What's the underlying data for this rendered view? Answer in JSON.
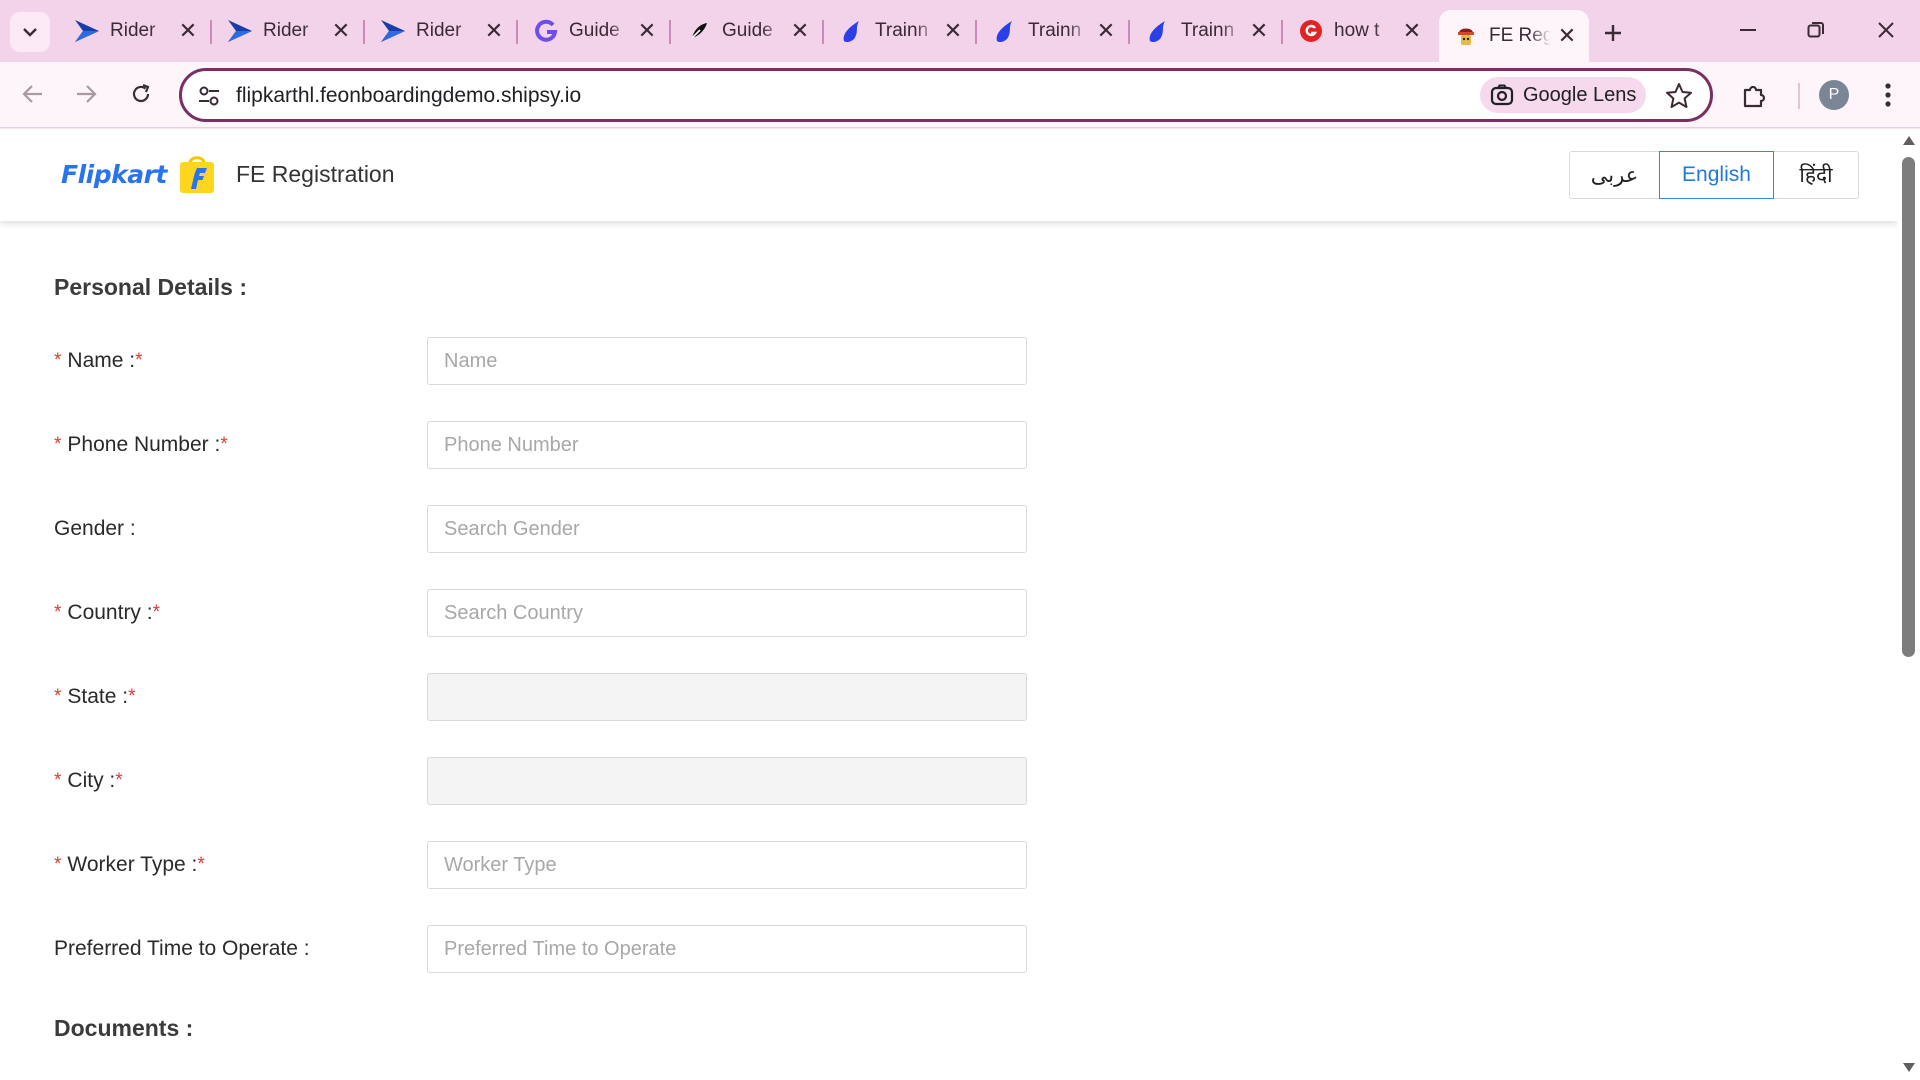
{
  "browser": {
    "tabs": [
      {
        "title": "Rider",
        "icon": "fe-logo-icon"
      },
      {
        "title": "Rider",
        "icon": "fe-logo-icon"
      },
      {
        "title": "Rider",
        "icon": "fe-logo-icon"
      },
      {
        "title": "Guide",
        "icon": "g-logo-icon"
      },
      {
        "title": "Guide",
        "icon": "feather-logo-icon"
      },
      {
        "title": "Trainn",
        "icon": "flame-logo-icon"
      },
      {
        "title": "Trainn",
        "icon": "flame-logo-icon"
      },
      {
        "title": "Trainn",
        "icon": "flame-logo-icon"
      },
      {
        "title": "how t",
        "icon": "red-g-logo-icon"
      },
      {
        "title": "FE Reg",
        "icon": "hat-logo-icon",
        "active": true
      }
    ],
    "url": "flipkarthl.feonboardingdemo.shipsy.io",
    "lens_label": "Google Lens",
    "profile_initial": "P",
    "accent_color": "#7a2f62"
  },
  "header": {
    "brand": "Flipkart",
    "title": "FE Registration",
    "languages": [
      "عربى",
      "English",
      "हिंदी"
    ],
    "selected_language": "English"
  },
  "form": {
    "personal_title": "Personal Details :",
    "fields": {
      "name": {
        "label": "Name :",
        "placeholder": "Name"
      },
      "phone": {
        "label": "Phone Number :",
        "placeholder": "Phone Number"
      },
      "gender": {
        "label": "Gender :",
        "placeholder": "Search Gender"
      },
      "country": {
        "label": "Country :",
        "placeholder": "Search Country"
      },
      "state": {
        "label": "State :",
        "placeholder": ""
      },
      "city": {
        "label": "City :",
        "placeholder": ""
      },
      "worker_type": {
        "label": "Worker Type :",
        "placeholder": "Worker Type"
      },
      "preferred_time": {
        "label": "Preferred Time to Operate :",
        "placeholder": "Preferred Time to Operate"
      }
    },
    "required_mark": "*",
    "documents_title": "Documents :"
  }
}
